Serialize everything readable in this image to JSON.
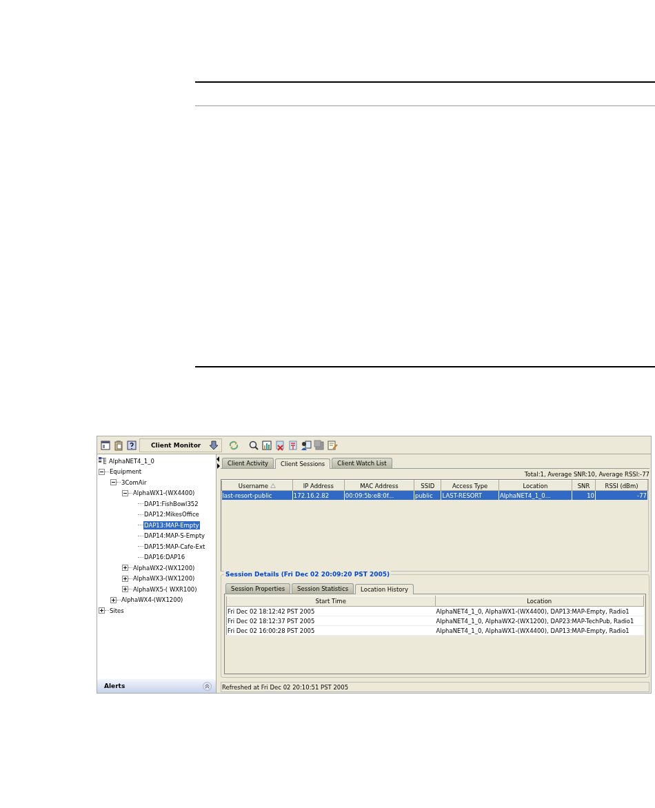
{
  "toolbar": {
    "view_selector": "Client Monitor"
  },
  "tree": {
    "root": {
      "label": "AlphaNET4_1_0",
      "selected": false,
      "children": [
        {
          "label": "Equipment",
          "expanded": true,
          "selected": false,
          "children": [
            {
              "label": "3ComAir",
              "expanded": true,
              "selected": false,
              "children": [
                {
                  "label": "AlphaWX1-(WX4400)",
                  "expanded": true,
                  "selected": false,
                  "children": [
                    {
                      "label": "DAP1:FishBowl352",
                      "selected": false
                    },
                    {
                      "label": "DAP12:MikesOffice",
                      "selected": false
                    },
                    {
                      "label": "DAP13:MAP-Empty",
                      "selected": true
                    },
                    {
                      "label": "DAP14:MAP-S-Empty",
                      "selected": false
                    },
                    {
                      "label": "DAP15:MAP-Cafe-Ext",
                      "selected": false
                    },
                    {
                      "label": "DAP16:DAP16",
                      "selected": false
                    }
                  ]
                },
                {
                  "label": "AlphaWX2-(WX1200)",
                  "expanded": false,
                  "selected": false
                },
                {
                  "label": "AlphaWX3-(WX1200)",
                  "expanded": false,
                  "selected": false
                },
                {
                  "label": "AlphaWX5-( WXR100)",
                  "expanded": false,
                  "selected": false
                }
              ]
            },
            {
              "label": "AlphaWX4-(WX1200)",
              "expanded": false,
              "selected": false
            }
          ]
        },
        {
          "label": "Sites",
          "expanded": false,
          "selected": false
        }
      ]
    }
  },
  "alerts_panel": {
    "title": "Alerts"
  },
  "tabs": [
    {
      "label": "Client Activity",
      "selected": false
    },
    {
      "label": "Client Sessions",
      "selected": true
    },
    {
      "label": "Client Watch List",
      "selected": false
    }
  ],
  "summary": "Total:1, Average SNR:10, Average RSSI:-77",
  "sessions_table": {
    "columns": [
      {
        "label": "Username",
        "sorted_ascending": true,
        "numeric": false
      },
      {
        "label": "IP Address",
        "sorted_ascending": false,
        "numeric": false
      },
      {
        "label": "MAC Address",
        "sorted_ascending": false,
        "numeric": false
      },
      {
        "label": "SSID",
        "sorted_ascending": false,
        "numeric": false
      },
      {
        "label": "Access Type",
        "sorted_ascending": false,
        "numeric": false
      },
      {
        "label": "Location",
        "sorted_ascending": false,
        "numeric": false
      },
      {
        "label": "SNR",
        "sorted_ascending": false,
        "numeric": true
      },
      {
        "label": "RSSI (dBm)",
        "sorted_ascending": false,
        "numeric": true
      }
    ],
    "rows": [
      {
        "selected": true,
        "cells": [
          "last-resort-public",
          "172.16.2.82",
          "00:09:5b:e8:0f...",
          "public",
          "LAST-RESORT",
          "AlphaNET4_1_0...",
          "10",
          "-77"
        ]
      }
    ]
  },
  "session_details": {
    "title": "Session Details (Fri Dec 02 20:09:20 PST 2005)",
    "tabs": [
      {
        "label": "Session Properties",
        "selected": false
      },
      {
        "label": "Session Statistics",
        "selected": false
      },
      {
        "label": "Location History",
        "selected": true
      }
    ],
    "columns": [
      "Start Time",
      "Location"
    ],
    "rows": [
      [
        "Fri Dec 02 18:12:42 PST 2005",
        "AlphaNET4_1_0, AlphaWX1-(WX4400), DAP13:MAP-Empty, Radio1"
      ],
      [
        "Fri Dec 02 18:12:37 PST 2005",
        "AlphaNET4_1_0, AlphaWX2-(WX1200), DAP23:MAP-TechPub, Radio1"
      ],
      [
        "Fri Dec 02 16:00:28 PST 2005",
        "AlphaNET4_1_0, AlphaWX1-(WX4400), DAP13:MAP-Empty, Radio1"
      ]
    ]
  },
  "status_bar": "Refreshed at Fri Dec 02 20:10:51 PST 2005"
}
